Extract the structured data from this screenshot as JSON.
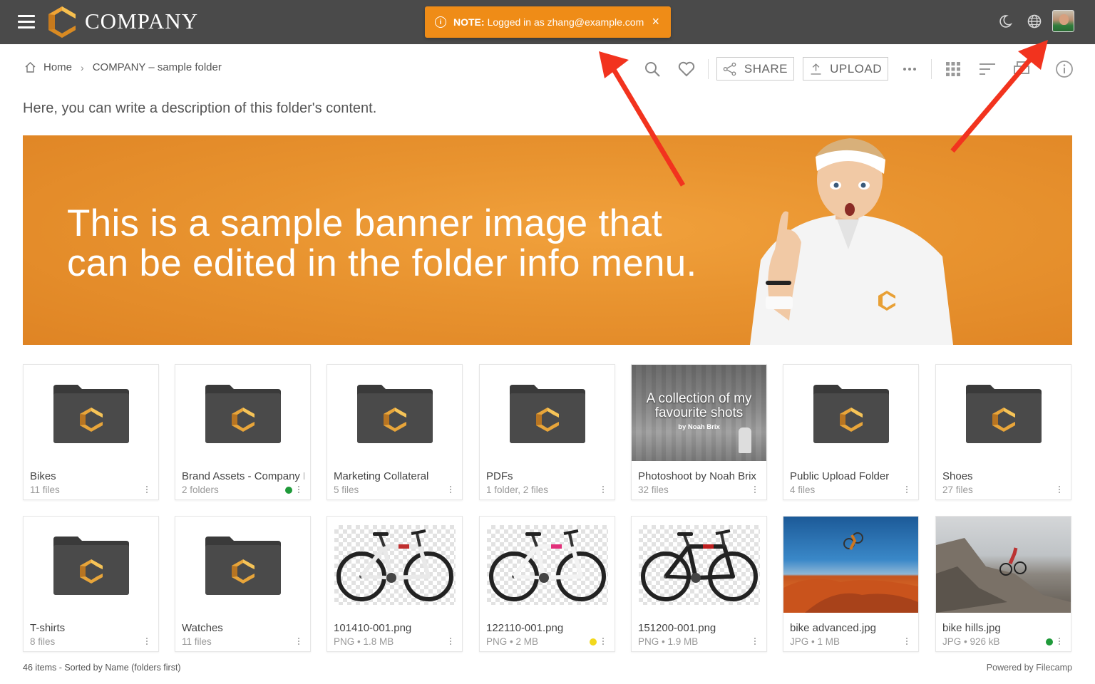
{
  "app": {
    "logo_text": "COMPANY",
    "brand_color": "#e8912c",
    "topbar_color": "#4a4a4a"
  },
  "notice": {
    "label": "NOTE:",
    "text": "Logged in as zhang@example.com",
    "close": "×",
    "color": "#ef8c17"
  },
  "topbar_icons": [
    "moon-icon",
    "globe-icon",
    "user-avatar"
  ],
  "breadcrumb": {
    "home": "Home",
    "separator": "›",
    "current": "COMPANY – sample folder"
  },
  "toolbar": {
    "share_label": "SHARE",
    "upload_label": "UPLOAD",
    "icons": [
      "search-icon",
      "heart-icon",
      "share-icon",
      "upload-icon",
      "more-icon",
      "grid-view-icon",
      "sort-icon",
      "print-icon",
      "info-icon"
    ]
  },
  "description": "Here, you can write a description of this folder's content.",
  "banner": {
    "line1": "This is a sample banner image that",
    "line2": "can be edited in the folder info menu."
  },
  "items": [
    {
      "name": "Bikes",
      "meta": "11 files",
      "type": "folder"
    },
    {
      "name": "Brand Assets - Company Images",
      "meta": "2 folders",
      "type": "folder",
      "dot": "#1f9a3a"
    },
    {
      "name": "Marketing Collateral",
      "meta": "5 files",
      "type": "folder"
    },
    {
      "name": "PDFs",
      "meta": "1 folder, 2 files",
      "type": "folder"
    },
    {
      "name": "Photoshoot by Noah Brix",
      "meta": "32 files",
      "type": "photo-folder",
      "cover_title": "A collection of my favourite shots",
      "cover_byline": "by Noah Brix"
    },
    {
      "name": "Public Upload Folder",
      "meta": "4 files",
      "type": "folder"
    },
    {
      "name": "Shoes",
      "meta": "27 files",
      "type": "folder"
    },
    {
      "name": "T-shirts",
      "meta": "8 files",
      "type": "folder"
    },
    {
      "name": "Watches",
      "meta": "11 files",
      "type": "folder"
    },
    {
      "name": "101410-001.png",
      "meta": "PNG • 1.8 MB",
      "type": "bike-white"
    },
    {
      "name": "122110-001.png",
      "meta": "PNG • 2 MB",
      "type": "bike-pink",
      "dot": "#f2d81d"
    },
    {
      "name": "151200-001.png",
      "meta": "PNG • 1.9 MB",
      "type": "bike-black"
    },
    {
      "name": "bike advanced.jpg",
      "meta": "JPG • 1 MB",
      "type": "photo-desert"
    },
    {
      "name": "bike hills.jpg",
      "meta": "JPG • 926 kB",
      "type": "photo-hills",
      "dot": "#1f9a3a"
    }
  ],
  "footer": {
    "status": "46 items - Sorted by Name (folders first)",
    "powered": "Powered by Filecamp"
  }
}
